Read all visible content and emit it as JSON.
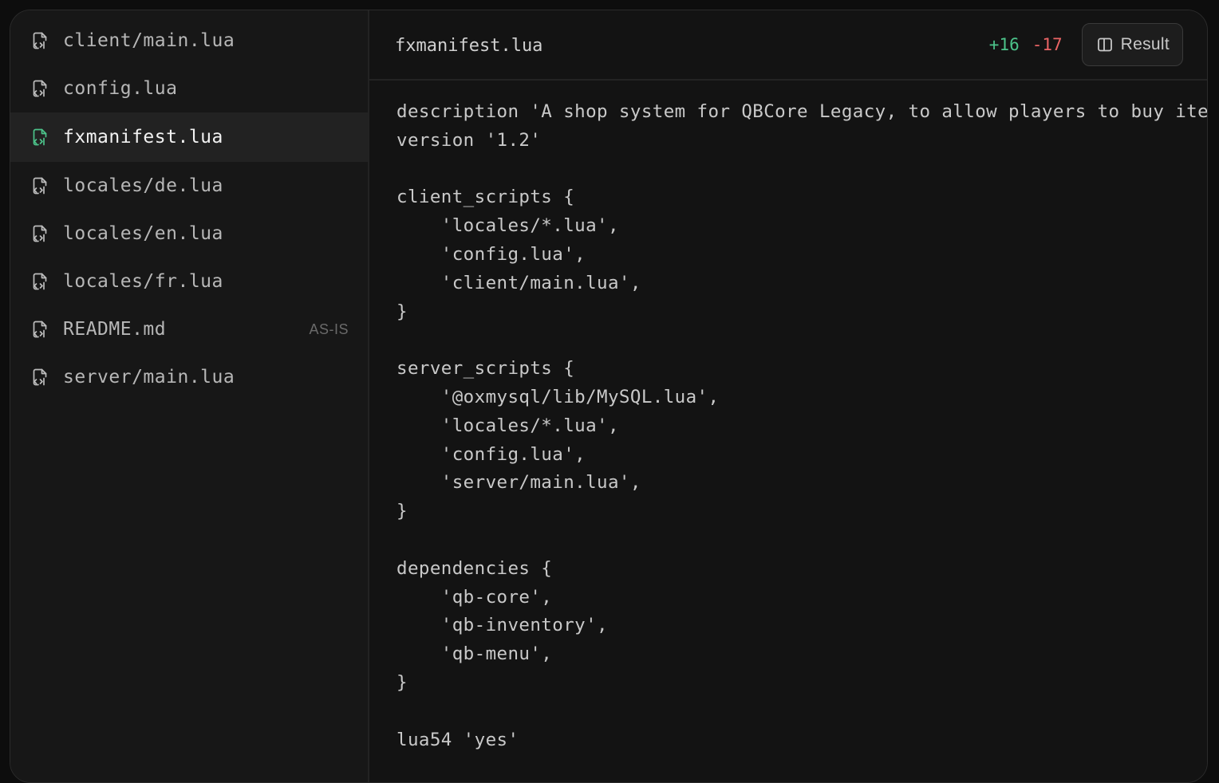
{
  "sidebar": {
    "files": [
      {
        "name": "client/main.lua",
        "icon": "file-code-icon",
        "active": false,
        "badge": ""
      },
      {
        "name": "config.lua",
        "icon": "file-code-icon",
        "active": false,
        "badge": ""
      },
      {
        "name": "fxmanifest.lua",
        "icon": "file-code-icon",
        "active": true,
        "badge": ""
      },
      {
        "name": "locales/de.lua",
        "icon": "file-code-icon",
        "active": false,
        "badge": ""
      },
      {
        "name": "locales/en.lua",
        "icon": "file-code-icon",
        "active": false,
        "badge": ""
      },
      {
        "name": "locales/fr.lua",
        "icon": "file-code-icon",
        "active": false,
        "badge": ""
      },
      {
        "name": "README.md",
        "icon": "file-code-icon",
        "active": false,
        "badge": "AS-IS"
      },
      {
        "name": "server/main.lua",
        "icon": "file-code-icon",
        "active": false,
        "badge": ""
      }
    ]
  },
  "editor": {
    "filename": "fxmanifest.lua",
    "diff": {
      "added": "+16",
      "removed": "-17",
      "added_color": "#4cc38a",
      "removed_color": "#ea6465"
    },
    "result_button": {
      "label": "Result",
      "icon": "split-view-icon"
    },
    "code": "description 'A shop system for QBCore Legacy, to allow players to buy ite\nversion '1.2'\n\nclient_scripts {\n    'locales/*.lua',\n    'config.lua',\n    'client/main.lua',\n}\n\nserver_scripts {\n    '@oxmysql/lib/MySQL.lua',\n    'locales/*.lua',\n    'config.lua',\n    'server/main.lua',\n}\n\ndependencies {\n    'qb-core',\n    'qb-inventory',\n    'qb-menu',\n}\n\nlua54 'yes'"
  },
  "colors": {
    "accent": "#4cc38a",
    "icon_default": "#bdbdbd"
  }
}
